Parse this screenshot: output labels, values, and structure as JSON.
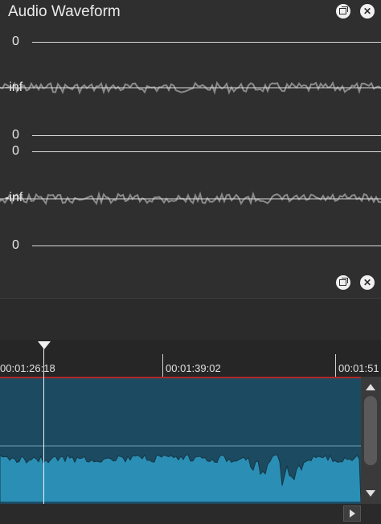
{
  "panel": {
    "title": "Audio Waveform",
    "channels": [
      {
        "top_label": "0",
        "mid_label": "-inf",
        "bottom_label": "0"
      },
      {
        "top_label": "0",
        "mid_label": "-inf",
        "bottom_label": "0"
      }
    ]
  },
  "timeline": {
    "timecodes": [
      "00:01:26:18",
      "00:01:39:02",
      "00:01:51"
    ]
  },
  "colors": {
    "track": "#1c4a60",
    "waveform": "#2b8fb5",
    "marker": "#b02828"
  }
}
